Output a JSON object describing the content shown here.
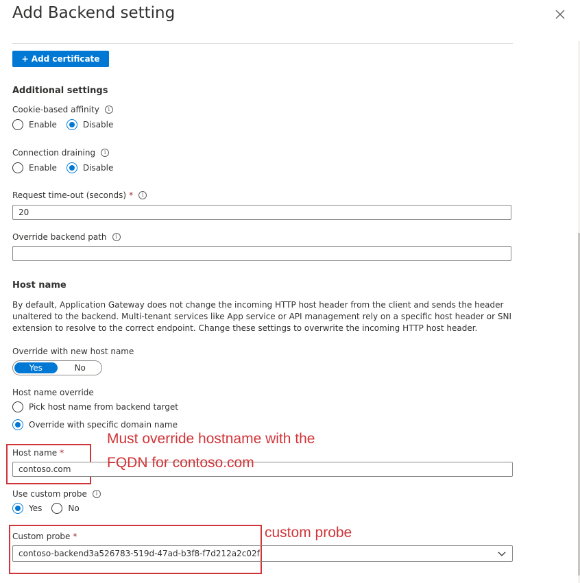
{
  "panel": {
    "title": "Add Backend setting",
    "close_label": "✕"
  },
  "certificate": {
    "add_button": "+ Add certificate"
  },
  "additional_settings": {
    "heading": "Additional settings",
    "cookie_affinity": {
      "label": "Cookie-based affinity",
      "options": [
        "Enable",
        "Disable"
      ],
      "selected": "Disable"
    },
    "connection_draining": {
      "label": "Connection draining",
      "options": [
        "Enable",
        "Disable"
      ],
      "selected": "Disable"
    },
    "request_timeout": {
      "label": "Request time-out (seconds)",
      "required_mark": "*",
      "value": "20"
    },
    "override_backend_path": {
      "label": "Override backend path",
      "value": ""
    }
  },
  "host_name": {
    "heading": "Host name",
    "description": "By default, Application Gateway does not change the incoming HTTP host header from the client and sends the header unaltered to the backend. Multi-tenant services like App service or API management rely on a specific host header or SNI extension to resolve to the correct endpoint. Change these settings to overwrite the incoming HTTP host header.",
    "override_new_host": {
      "label": "Override with new host name",
      "options": [
        "Yes",
        "No"
      ],
      "selected": "Yes"
    },
    "host_name_override": {
      "label": "Host name override",
      "options": [
        "Pick host name from backend target",
        "Override with specific domain name"
      ],
      "selected": "Override with specific domain name"
    },
    "host_name_field": {
      "label": "Host name",
      "required_mark": "*",
      "value": "contoso.com"
    },
    "use_custom_probe": {
      "label": "Use custom probe",
      "options": [
        "Yes",
        "No"
      ],
      "selected": "Yes"
    },
    "custom_probe": {
      "label": "Custom probe",
      "required_mark": "*",
      "value": "contoso-backend3a526783-519d-47ad-b3f8-f7d212a2c02f"
    }
  },
  "annotations": {
    "hostname_note_line1": "Must override hostname with the",
    "hostname_note_line2": "FQDN for contoso.com",
    "probe_note": "custom probe",
    "color": "#d13438"
  },
  "colors": {
    "accent": "#0078d4",
    "text": "#323130",
    "required": "#a4262c"
  },
  "icons": {
    "info": "info-icon",
    "close": "close-icon",
    "chevron": "chevron-down-icon"
  }
}
